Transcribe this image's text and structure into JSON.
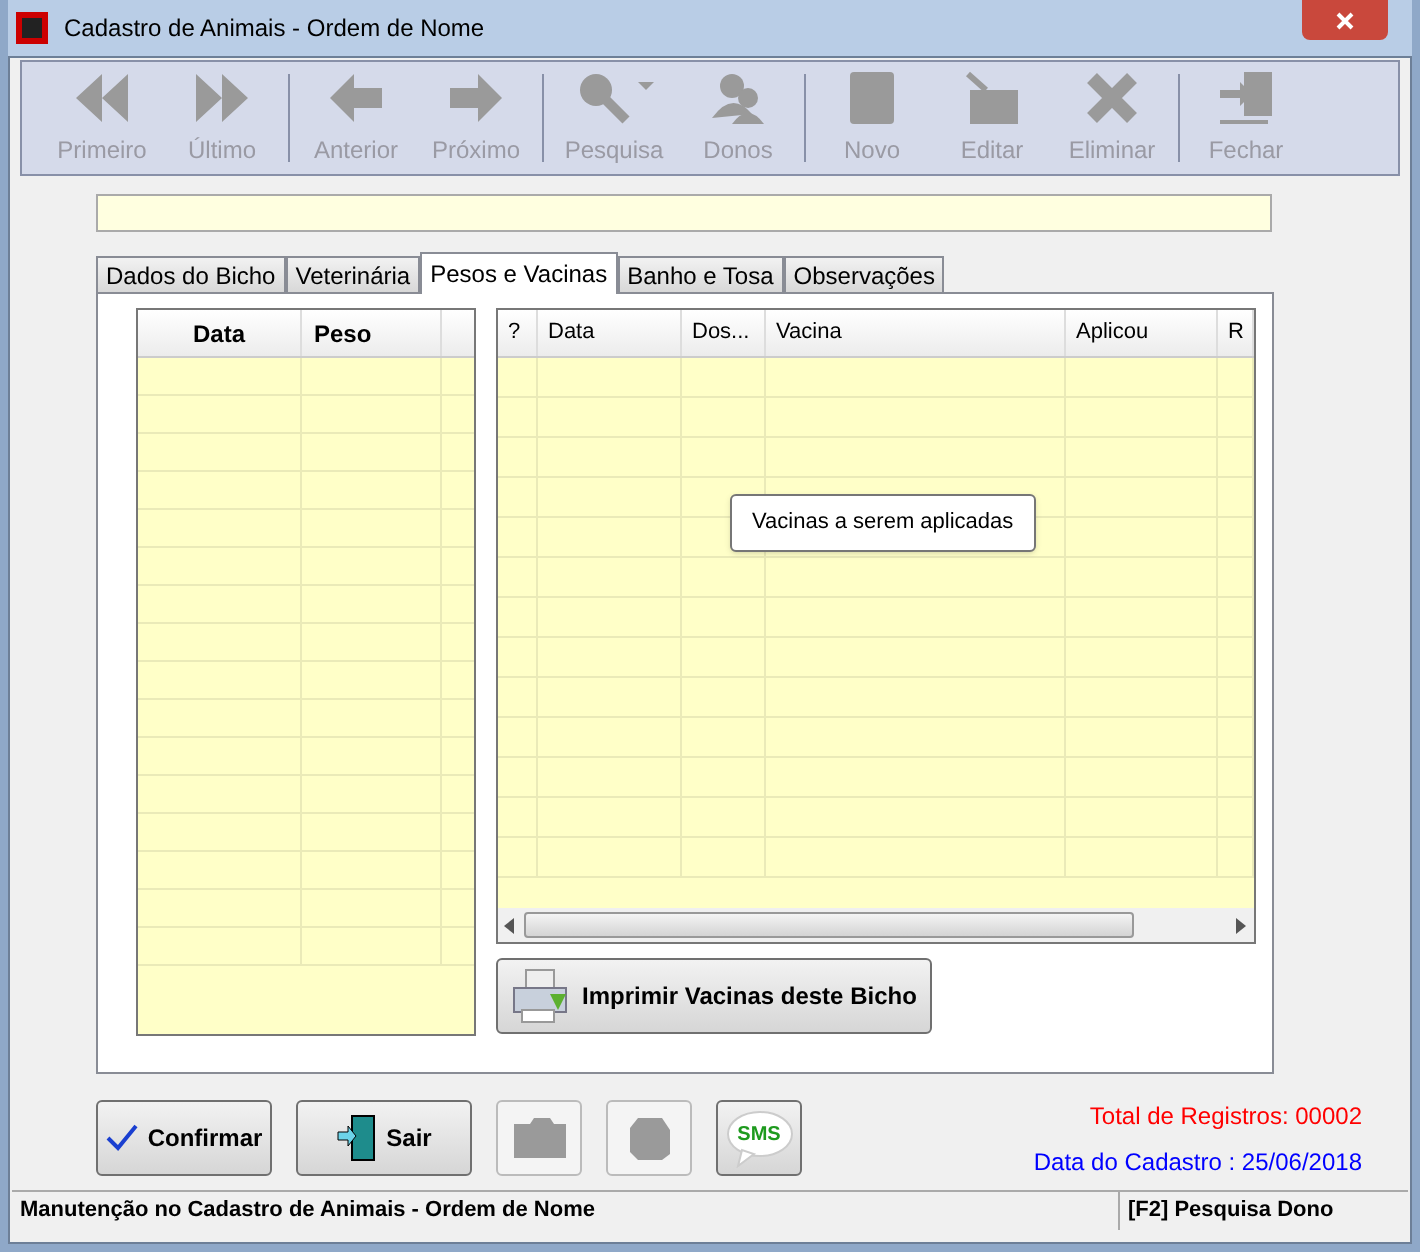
{
  "window": {
    "title": "Cadastro de Animais - Ordem de Nome"
  },
  "toolbar": [
    {
      "label": "Primeiro",
      "disabled": true
    },
    {
      "label": "Último",
      "disabled": true
    },
    {
      "label": "Anterior",
      "disabled": true
    },
    {
      "label": "Próximo",
      "disabled": true
    },
    {
      "label": "Pesquisa",
      "disabled": true
    },
    {
      "label": "Donos",
      "disabled": true
    },
    {
      "label": "Novo",
      "disabled": true
    },
    {
      "label": "Editar",
      "disabled": true
    },
    {
      "label": "Eliminar",
      "disabled": true
    },
    {
      "label": "Fechar",
      "disabled": true
    }
  ],
  "tabs": [
    {
      "label": "Dados do Bicho",
      "selected": false
    },
    {
      "label": "Veterinária",
      "selected": false
    },
    {
      "label": "Pesos e Vacinas",
      "selected": true
    },
    {
      "label": "Banho e Tosa",
      "selected": false
    },
    {
      "label": "Observações",
      "selected": false
    }
  ],
  "weights_table": {
    "columns": [
      "Data",
      "Peso"
    ]
  },
  "vaccines_table": {
    "columns": [
      "?",
      "Data",
      "Dos...",
      "Vacina",
      "Aplicou",
      "R"
    ]
  },
  "tooltip": "Vacinas a serem aplicadas",
  "print_button": "Imprimir Vacinas deste Bicho",
  "buttons": [
    {
      "kind": "text",
      "label": "Confirmar",
      "disabled": false
    },
    {
      "kind": "text",
      "label": "Sair",
      "disabled": false
    },
    {
      "kind": "icon",
      "disabled": true
    },
    {
      "kind": "icon",
      "disabled": true
    },
    {
      "kind": "sms",
      "disabled": false
    }
  ],
  "sms_label": "SMS",
  "total": "Total de Registros: 00002",
  "date": "Data do Cadastro : 25/06/2018",
  "status_bar": [
    "Manutenção no Cadastro de Animais - Ordem de Nome",
    "[F2] Pesquisa Dono"
  ]
}
